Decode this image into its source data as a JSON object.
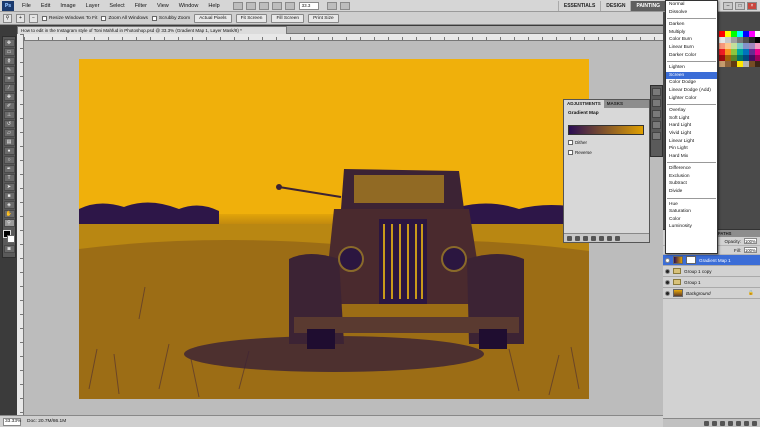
{
  "menubar": {
    "logo": "Ps",
    "items": [
      "File",
      "Edit",
      "Image",
      "Layer",
      "Select",
      "Filter",
      "View",
      "Window",
      "Help"
    ],
    "zoom": "33.3",
    "workspaces": [
      "ESSENTIALS",
      "DESIGN",
      "PAINTING"
    ]
  },
  "options": {
    "resize_windows": "Resize Windows To Fit",
    "zoom_all": "Zoom All Windows",
    "scrubby_zoom": "Scrubby Zoom",
    "actual_pixels": "Actual Pixels",
    "fit_screen": "Fit Screen",
    "fill_screen": "Fill Screen",
    "print_size": "Print Size"
  },
  "document": {
    "tab_title": "How to edit in the Instagram style of Toni Mahfud in Photoshop.psd @ 33.3% (Gradient Map 1, Layer Mask/8) *",
    "status_zoom": "33.33%",
    "status_doc": "Doc: 20.7M/86.1M"
  },
  "adjustments": {
    "tabs": [
      "ADJUSTMENTS",
      "MASKS"
    ],
    "title": "Gradient Map",
    "dither": "Dither",
    "reverse": "Reverse"
  },
  "blend_modes": {
    "groups": [
      [
        "Normal",
        "Dissolve"
      ],
      [
        "Darken",
        "Multiply",
        "Color Burn",
        "Linear Burn",
        "Darker Color"
      ],
      [
        "Lighten",
        "Screen",
        "Color Dodge",
        "Linear Dodge (Add)",
        "Lighter Color"
      ],
      [
        "Overlay",
        "Soft Light",
        "Hard Light",
        "Vivid Light",
        "Linear Light",
        "Pin Light",
        "Hard Mix"
      ],
      [
        "Difference",
        "Exclusion",
        "Subtract",
        "Divide"
      ],
      [
        "Hue",
        "Saturation",
        "Color",
        "Luminosity"
      ]
    ],
    "highlighted": "Screen"
  },
  "layers": {
    "tabs": [
      "LAYERS",
      "CHANNELS",
      "PATHS"
    ],
    "opacity_label": "Opacity:",
    "opacity_value": "100%",
    "fill_label": "Fill:",
    "fill_value": "100%",
    "items": [
      {
        "name": "Gradient Map 1",
        "selected": true
      },
      {
        "name": "Group 1 copy",
        "selected": false
      },
      {
        "name": "Group 1",
        "selected": false
      },
      {
        "name": "Background",
        "selected": false
      }
    ]
  },
  "colors": {
    "photo_yellow": "#f2b20b",
    "photo_purple": "#2a0d55",
    "selection_blue": "#3b6dd7"
  }
}
